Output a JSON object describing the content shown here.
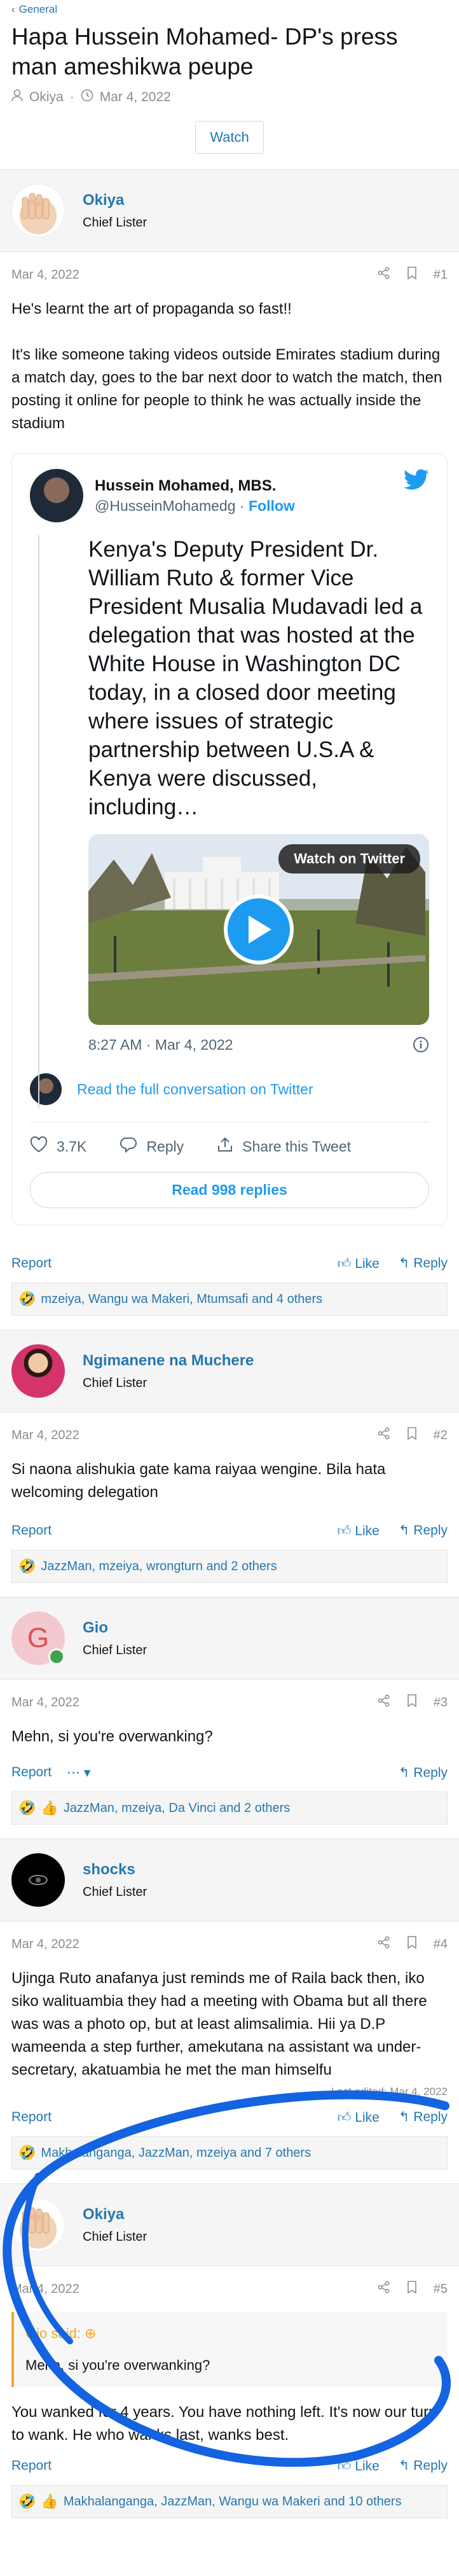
{
  "breadcrumb": "General",
  "thread": {
    "title": "Hapa Hussein Mohamed- DP's press man ameshikwa peupe",
    "author": "Okiya",
    "date": "Mar 4, 2022",
    "watch_label": "Watch"
  },
  "colors": {
    "link": "#2577b1",
    "twitter": "#1d9bf0",
    "annotation": "#1463e0",
    "quote": "#f5a623"
  },
  "posts": [
    {
      "user": "Okiya",
      "title": "Chief Lister",
      "date": "Mar 4, 2022",
      "num": "#1",
      "body": [
        "He's learnt the art of propaganda so fast!!",
        "It's like someone taking videos outside Emirates stadium during a match day, goes to the bar next door to watch the match, then posting it online for people to think he was actually inside the stadium"
      ],
      "report": "Report",
      "like": "Like",
      "reply": "Reply",
      "reactions": "mzeiya, Wangu wa Makeri, Mtumsafi and 4 others"
    },
    {
      "user": "Ngimanene na Muchere",
      "title": "Chief Lister",
      "date": "Mar 4, 2022",
      "num": "#2",
      "body": [
        "Si naona alishukia gate kama raiyaa wengine. Bila hata welcoming delegation"
      ],
      "report": "Report",
      "like": "Like",
      "reply": "Reply",
      "reactions": "JazzMan, mzeiya, wrongturn and 2 others"
    },
    {
      "user": "Gio",
      "avatar_letter": "G",
      "title": "Chief Lister",
      "date": "Mar 4, 2022",
      "num": "#3",
      "body": [
        "Mehn, si you're overwanking?"
      ],
      "report": "Report",
      "more": "⋯",
      "reply": "Reply",
      "reactions": "JazzMan, mzeiya, Da Vinci and 2 others"
    },
    {
      "user": "shocks",
      "title": "Chief Lister",
      "date": "Mar 4, 2022",
      "num": "#4",
      "body": [
        "Ujinga Ruto anafanya just reminds me of Raila back then, iko siko walituambia they had a meeting with Obama but all there was was a photo op, but at least alimsalimia. Hii ya D.P wameenda a step further, amekutana na assistant wa under-secretary, akatuambia he met the man himselfu"
      ],
      "last_edited": "Last edited: Mar 4, 2022",
      "report": "Report",
      "like": "Like",
      "reply": "Reply",
      "reactions": "Makhalanganga, JazzMan, mzeiya and 7 others"
    },
    {
      "user": "Okiya",
      "title": "Chief Lister",
      "date": "Mar 4, 2022",
      "num": "#5",
      "quote_head": "Gio said:",
      "quote_body": "Mehn, si you're overwanking?",
      "body": [
        "You wanked for 4 years. You have nothing left. It's now our turn to wank. He who wanks last, wanks best."
      ],
      "report": "Report",
      "like": "Like",
      "reply": "Reply",
      "reactions": "Makhalanganga, JazzMan, Wangu wa Makeri and 10 others"
    }
  ],
  "tweet": {
    "name": "Hussein Mohamed, MBS.",
    "handle": "@HusseinMohamedg",
    "follow": "Follow",
    "text": "Kenya's Deputy President Dr. William Ruto & former Vice President Musalia Mudavadi led a delegation that was hosted at the White House in Washington DC today, in a closed door meeting where issues of strategic partnership between U.S.A & Kenya were discussed, including…",
    "watch_label": "Watch on Twitter",
    "time": "8:27 AM · Mar 4, 2022",
    "conversation": "Read the full conversation on Twitter",
    "likes": "3.7K",
    "reply": "Reply",
    "share": "Share this Tweet",
    "replies": "Read 998 replies"
  }
}
